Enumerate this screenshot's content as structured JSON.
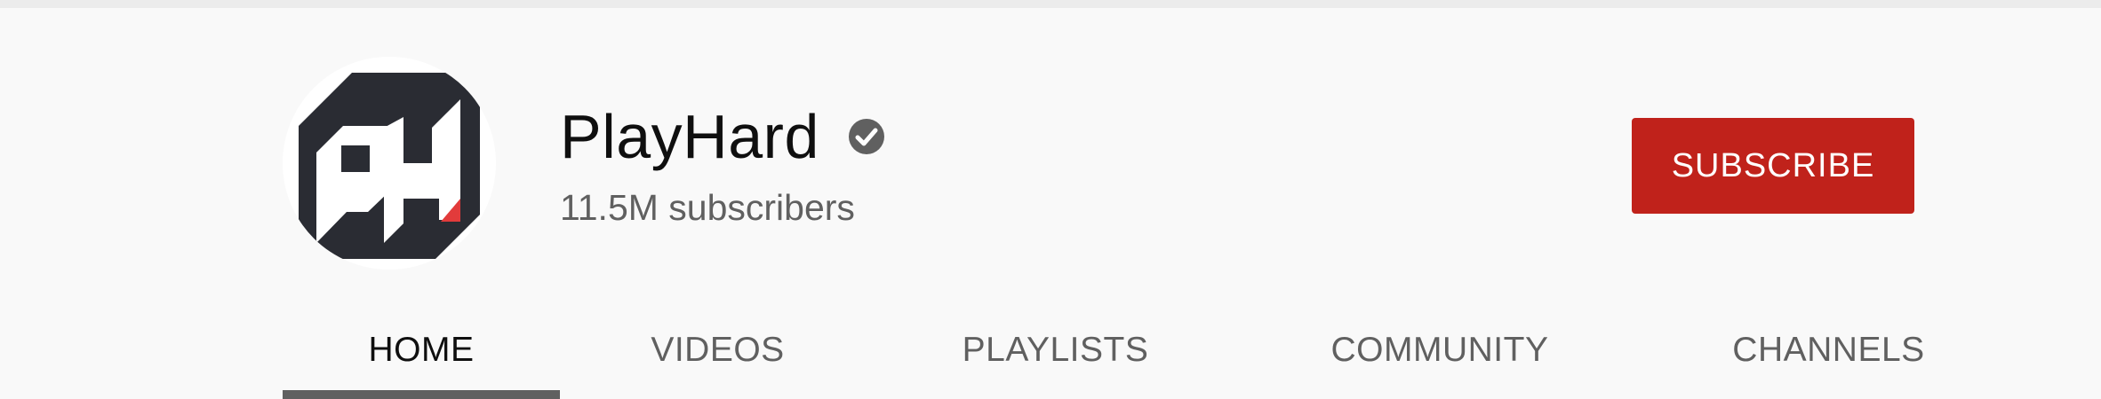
{
  "channel": {
    "name": "PlayHard",
    "subscribers": "11.5M subscribers",
    "avatar_icon": "playhard-logo-icon",
    "verified_icon": "verified-check-icon"
  },
  "subscribe_button": {
    "label": "SUBSCRIBE",
    "color": "#c0221b"
  },
  "tabs": [
    {
      "label": "HOME",
      "active": true
    },
    {
      "label": "VIDEOS",
      "active": false
    },
    {
      "label": "PLAYLISTS",
      "active": false
    },
    {
      "label": "COMMUNITY",
      "active": false
    },
    {
      "label": "CHANNELS",
      "active": false
    }
  ]
}
